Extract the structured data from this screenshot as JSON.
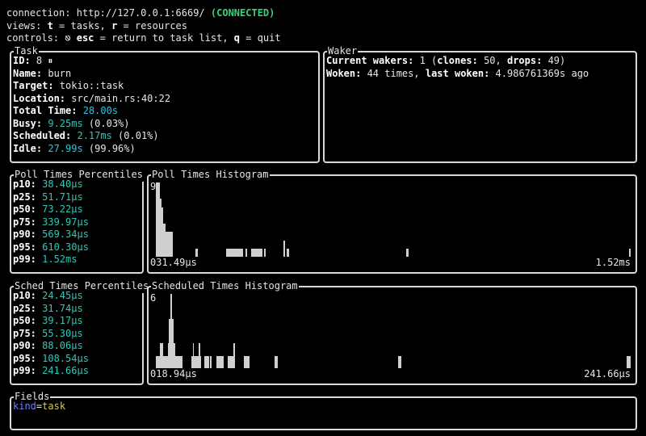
{
  "header": {
    "connection_label": "connection: ",
    "url": "http://127.0.0.1:6669/",
    "status": "(CONNECTED)",
    "views_prefix": "views: ",
    "views_t": "t",
    "views_t_desc": " = tasks, ",
    "views_r": "r",
    "views_r_desc": " = resources",
    "controls_prefix": "controls: ",
    "controls_esc_icon": "⎋",
    "controls_esc": "esc",
    "controls_esc_desc": " = return to task list, ",
    "controls_q": "q",
    "controls_q_desc": " = quit"
  },
  "task": {
    "title": "Task",
    "id_label": "ID:",
    "id_value": " 8 ⏸",
    "name_label": "Name:",
    "name_value": " burn",
    "target_label": "Target:",
    "target_value": " tokio::task",
    "location_label": "Location:",
    "location_value": " src/main.rs:40:22",
    "total_label": "Total Time:",
    "total_value": " 28.00s",
    "busy_label": "Busy:",
    "busy_value": " 9.25ms",
    "busy_pct": " (0.03%)",
    "sched_label": "Scheduled:",
    "sched_value": " 2.17ms",
    "sched_pct": " (0.01%)",
    "idle_label": "Idle:",
    "idle_value": " 27.99s",
    "idle_pct": " (99.96%)"
  },
  "waker": {
    "title": "Waker",
    "current_label": "Current wakers:",
    "current_value": " 1 (",
    "clones_label": "clones:",
    "clones_value": " 50, ",
    "drops_label": "drops:",
    "drops_value": " 49)",
    "woken_label": "Woken:",
    "woken_value": " 44 times, ",
    "last_label": "last woken:",
    "last_value": " 4.986761369s ago"
  },
  "poll_percentiles": {
    "title": "Poll Times Percentiles",
    "items": [
      {
        "label": "p10:",
        "value": " 38.40μs"
      },
      {
        "label": "p25:",
        "value": " 51.71μs"
      },
      {
        "label": "p50:",
        "value": " 73.22μs"
      },
      {
        "label": "p75:",
        "value": " 339.97μs"
      },
      {
        "label": "p90:",
        "value": " 569.34μs"
      },
      {
        "label": "p95:",
        "value": " 610.30μs"
      },
      {
        "label": "p99:",
        "value": " 1.52ms"
      }
    ]
  },
  "poll_histogram": {
    "title": "Poll Times Histogram",
    "max_label": "9",
    "min_x_label": "031.49μs",
    "max_x_label": "1.52ms",
    "max": 9,
    "bins": [
      9,
      9,
      7,
      6,
      4,
      3,
      3,
      3,
      3,
      0,
      0,
      0,
      0,
      0,
      0,
      0,
      0,
      0,
      0,
      0,
      0,
      1,
      0,
      0,
      0,
      0,
      0,
      0,
      0,
      0,
      0,
      0,
      0,
      0,
      0,
      0,
      0,
      1,
      1,
      1,
      1,
      1,
      1,
      1,
      1,
      1,
      0,
      1,
      0,
      0,
      1,
      1,
      1,
      1,
      1,
      1,
      0,
      1,
      0,
      0,
      0,
      0,
      0,
      0,
      0,
      0,
      0,
      2,
      0,
      1,
      0,
      0,
      0,
      0,
      0,
      0,
      0,
      0,
      0,
      0,
      0,
      0,
      0,
      0,
      0,
      0,
      0,
      0,
      0,
      0,
      0,
      0,
      0,
      0,
      0,
      0,
      0,
      0,
      0,
      0,
      0,
      0,
      0,
      0,
      0,
      0,
      0,
      0,
      0,
      0,
      0,
      0,
      0,
      0,
      0,
      0,
      0,
      0,
      0,
      0,
      0,
      0,
      0,
      0,
      0,
      0,
      0,
      0,
      0,
      0,
      0,
      0,
      1,
      0,
      0,
      0,
      0,
      0,
      0,
      0,
      0,
      0,
      0,
      0,
      0,
      0,
      0,
      0,
      0,
      0,
      0,
      0,
      0,
      0,
      0,
      0,
      0,
      0,
      0,
      0,
      0,
      0,
      0,
      0,
      0,
      0,
      0,
      0,
      0,
      0,
      0,
      0,
      0,
      0,
      0,
      0,
      0,
      0,
      0,
      0,
      0,
      0,
      0,
      0,
      0,
      0,
      0,
      0,
      0,
      0,
      0,
      0,
      0,
      0,
      0,
      0,
      0,
      0,
      0,
      0,
      0,
      0,
      0,
      0,
      0,
      0,
      0,
      0,
      0,
      0,
      0,
      0,
      0,
      0,
      0,
      0,
      0,
      0,
      0,
      0,
      0,
      0,
      0,
      0,
      0,
      0,
      0,
      0,
      0,
      0,
      0,
      0,
      0,
      0,
      0,
      0,
      0,
      0,
      0,
      0,
      0,
      0,
      0,
      0,
      0,
      0,
      0,
      0,
      0,
      1
    ]
  },
  "sched_percentiles": {
    "title": "Sched Times Percentiles",
    "items": [
      {
        "label": "p10:",
        "value": " 24.45μs"
      },
      {
        "label": "p25:",
        "value": " 31.74μs"
      },
      {
        "label": "p50:",
        "value": " 39.17μs"
      },
      {
        "label": "p75:",
        "value": " 55.30μs"
      },
      {
        "label": "p90:",
        "value": " 88.06μs"
      },
      {
        "label": "p95:",
        "value": " 108.54μs"
      },
      {
        "label": "p99:",
        "value": " 241.66μs"
      }
    ]
  },
  "sched_histogram": {
    "title": "Scheduled Times Histogram",
    "max_label": "6",
    "min_x_label": "018.94μs",
    "max_x_label": "241.66μs",
    "max": 6,
    "bins": [
      1,
      1,
      1,
      2,
      2,
      1,
      1,
      1,
      2,
      4,
      6,
      4,
      2,
      1,
      1,
      1,
      1,
      1,
      0,
      0,
      0,
      0,
      0,
      0,
      1,
      2,
      1,
      1,
      1,
      2,
      1,
      0,
      0,
      1,
      1,
      1,
      0,
      1,
      0,
      0,
      0,
      1,
      1,
      1,
      1,
      1,
      0,
      0,
      0,
      1,
      1,
      1,
      1,
      2,
      0,
      0,
      0,
      0,
      0,
      0,
      1,
      1,
      1,
      1,
      0,
      0,
      0,
      0,
      0,
      0,
      0,
      0,
      0,
      0,
      0,
      0,
      0,
      0,
      0,
      0,
      0,
      1,
      1,
      0,
      0,
      0,
      0,
      0,
      0,
      0,
      0,
      0,
      0,
      0,
      0,
      0,
      0,
      0,
      0,
      0,
      0,
      0,
      0,
      0,
      0,
      0,
      0,
      0,
      0,
      0,
      0,
      0,
      0,
      0,
      0,
      0,
      0,
      0,
      0,
      0,
      0,
      0,
      0,
      0,
      0,
      0,
      0,
      0,
      0,
      0,
      0,
      0,
      0,
      0,
      0,
      0,
      0,
      0,
      0,
      0,
      0,
      0,
      0,
      0,
      0,
      0,
      0,
      0,
      0,
      0,
      0,
      0,
      0,
      0,
      0,
      0,
      0,
      0,
      0,
      0,
      0,
      0,
      0,
      0,
      0,
      1,
      1,
      0,
      0,
      0,
      0,
      0,
      0,
      0,
      0,
      0,
      0,
      0,
      0,
      0,
      0,
      0,
      0,
      0,
      0,
      0,
      0,
      0,
      0,
      0,
      0,
      0,
      0,
      0,
      0,
      0,
      0,
      0,
      0,
      0,
      0,
      0,
      0,
      0,
      0,
      0,
      0,
      0,
      0,
      0,
      0,
      0,
      0,
      0,
      0,
      0,
      0,
      0,
      0,
      0,
      0,
      0,
      0,
      0,
      0,
      0,
      0,
      0,
      0,
      0,
      0,
      0,
      0,
      0,
      0,
      0,
      0,
      0,
      0,
      0,
      0,
      0,
      0,
      0,
      0,
      0,
      0,
      0,
      0,
      0,
      0,
      0,
      0,
      0,
      0,
      0,
      0,
      0,
      0,
      0,
      0,
      0,
      0,
      0,
      0,
      0,
      0,
      0,
      0,
      0,
      0,
      0,
      0,
      0,
      0,
      0,
      0,
      0,
      0,
      0,
      0,
      0,
      0,
      0,
      0,
      0,
      0,
      0,
      0,
      0,
      0,
      0,
      0,
      0,
      0,
      0,
      0,
      0,
      0,
      0,
      0,
      0,
      0,
      0,
      0,
      0,
      0,
      0,
      0,
      0,
      0,
      0,
      0,
      0,
      0,
      0,
      0,
      0,
      0,
      0,
      1,
      1,
      1
    ]
  },
  "fields": {
    "title": "Fields",
    "key": "kind",
    "eq": "=",
    "value": "task"
  }
}
